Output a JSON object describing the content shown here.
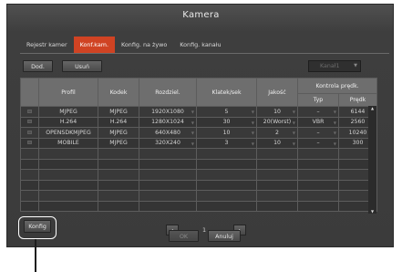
{
  "window": {
    "title": "Kamera"
  },
  "tabs": [
    {
      "label": "Rejestr kamer",
      "active": false
    },
    {
      "label": "Konf.kam.",
      "active": true
    },
    {
      "label": "Konfig. na żywo",
      "active": false
    },
    {
      "label": "Konfig. kanału",
      "active": false
    }
  ],
  "toolbar": {
    "add_label": "Dod.",
    "delete_label": "Usuń",
    "channel_value": "Kanał1"
  },
  "table": {
    "headers": {
      "profile": "Profil",
      "codec": "Kodek",
      "resolution": "Rozdziel.",
      "framerate": "Klatek/sek",
      "quality": "Jakość",
      "bitrate_group": "Kontrola prędk.",
      "type": "Typ",
      "speed": "Prędk"
    },
    "rows": [
      {
        "profile": "MJPEG",
        "codec": "MJPEG",
        "resolution": "1920X1080",
        "framerate": "5",
        "quality": "10",
        "type": "–",
        "speed": "6144"
      },
      {
        "profile": "H.264",
        "codec": "H.264",
        "resolution": "1280X1024",
        "framerate": "30",
        "quality": "20(Worst)",
        "type": "VBR",
        "speed": "2560"
      },
      {
        "profile": "OPENSDKMJPEG",
        "codec": "MJPEG",
        "resolution": "640X480",
        "framerate": "10",
        "quality": "2",
        "type": "–",
        "speed": "10240"
      },
      {
        "profile": "MOBILE",
        "codec": "MJPEG",
        "resolution": "320X240",
        "framerate": "3",
        "quality": "10",
        "type": "–",
        "speed": "300"
      }
    ],
    "empty_rows": 6
  },
  "config_button": {
    "label": "Konfig"
  },
  "pagination": {
    "current": "1"
  },
  "footer": {
    "ok_label": "OK",
    "cancel_label": "Anuluj"
  },
  "colors": {
    "accent": "#d04323"
  }
}
